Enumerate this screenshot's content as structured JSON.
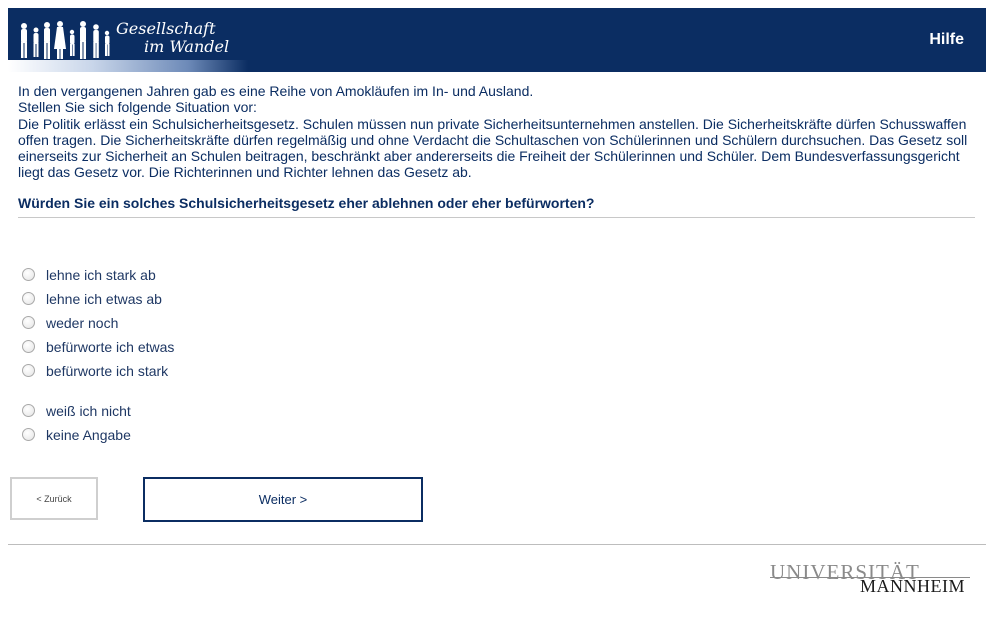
{
  "header": {
    "logo_line1": "Gesellschaft",
    "logo_line2": "im Wandel",
    "help_label": "Hilfe",
    "background_color": "#0b2d62"
  },
  "intro": {
    "lines": [
      "In den vergangenen Jahren gab es eine Reihe von Amokläufen im In- und Ausland.",
      "Stellen Sie sich folgende Situation vor:",
      "Die Politik erlässt ein Schulsicherheitsgesetz. Schulen müssen nun private Sicherheitsunternehmen anstellen. Die Sicherheitskräfte dürfen Schusswaffen offen tragen. Die Sicherheitskräfte dürfen regelmäßig und ohne Verdacht die Schultaschen von Schülerinnen und Schülern durchsuchen. Das Gesetz soll einerseits zur Sicherheit an Schulen beitragen, beschränkt aber andererseits die Freiheit der Schülerinnen und Schüler. Dem Bundesverfassungsgericht liegt das Gesetz vor. Die Richterinnen und Richter lehnen das Gesetz ab."
    ]
  },
  "question": {
    "text": "Würden Sie ein solches Schulsicherheitsgesetz eher ablehnen oder eher befürworten?"
  },
  "options": [
    {
      "label": "lehne ich stark ab",
      "selected": false
    },
    {
      "label": "lehne ich etwas ab",
      "selected": false
    },
    {
      "label": "weder noch",
      "selected": false
    },
    {
      "label": "befürworte ich etwas",
      "selected": false
    },
    {
      "label": "befürworte ich stark",
      "selected": false
    },
    {
      "label": "weiß ich nicht",
      "selected": false
    },
    {
      "label": "keine Angabe",
      "selected": false
    }
  ],
  "nav": {
    "back_label": "< Zurück",
    "next_label": "Weiter >"
  },
  "footer": {
    "university_line1": "UNIVERSITÄT",
    "university_line2": "MANNHEIM"
  }
}
